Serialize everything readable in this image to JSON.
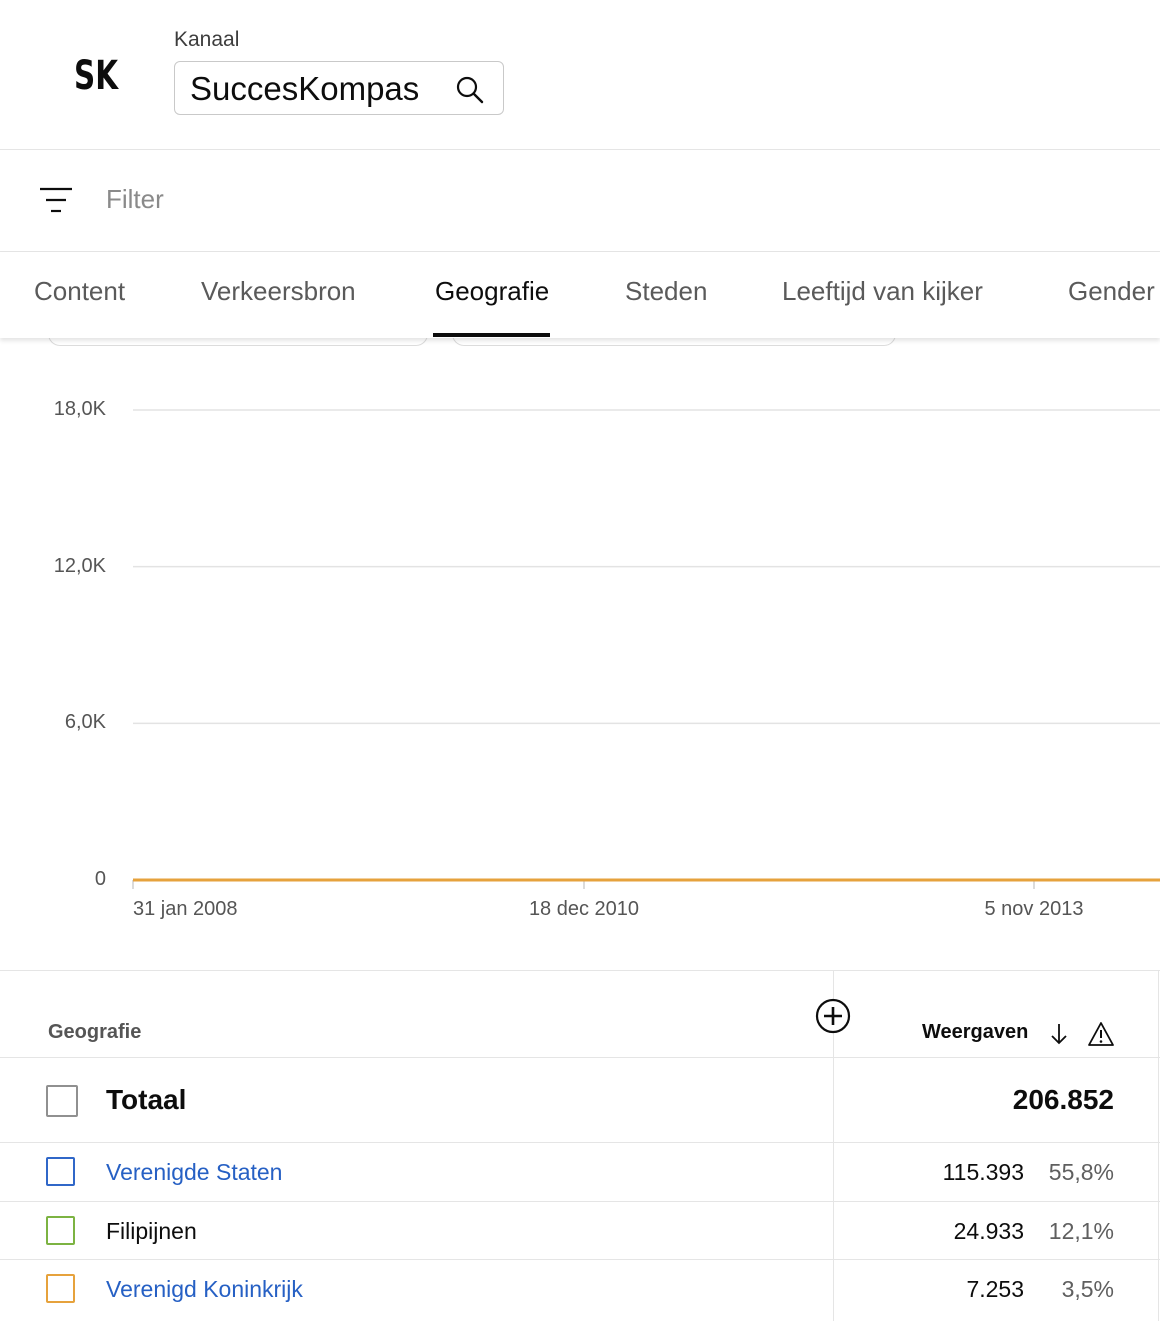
{
  "header": {
    "logo_text": "SK",
    "channel_label": "Kanaal",
    "channel_name": "SuccesKompas"
  },
  "filter": {
    "label": "Filter"
  },
  "tabs": [
    {
      "label": "Content",
      "active": false
    },
    {
      "label": "Verkeersbron",
      "active": false
    },
    {
      "label": "Geografie",
      "active": true
    },
    {
      "label": "Steden",
      "active": false
    },
    {
      "label": "Leeftijd van kijker",
      "active": false
    },
    {
      "label": "Gender",
      "active": false
    }
  ],
  "chart_data": {
    "type": "line",
    "y_ticks": [
      "18,0K",
      "12,0K",
      "6,0K",
      "0"
    ],
    "y_tick_values": [
      18000,
      12000,
      6000,
      0
    ],
    "ylim": [
      0,
      18000
    ],
    "x_ticks": [
      "31 jan 2008",
      "18 dec 2010",
      "5 nov 2013"
    ],
    "grid": true,
    "series": [
      {
        "color": "#e6a23c",
        "values": [
          0,
          0,
          0,
          0
        ]
      }
    ]
  },
  "table": {
    "col_geo": "Geografie",
    "col_views": "Weergaven",
    "total": {
      "label": "Totaal",
      "value": "206.852"
    },
    "rows": [
      {
        "country": "Verenigde Staten",
        "views": "115.393",
        "pct": "55,8%",
        "color": "#3067c8",
        "link": true
      },
      {
        "country": "Filipijnen",
        "views": "24.933",
        "pct": "12,1%",
        "color": "#7cb342",
        "link": false
      },
      {
        "country": "Verenigd Koninkrijk",
        "views": "7.253",
        "pct": "3,5%",
        "color": "#e6a23c",
        "link": true
      }
    ]
  },
  "colors": {
    "accent_link": "#2660c4",
    "chart_line": "#e6a23c"
  }
}
